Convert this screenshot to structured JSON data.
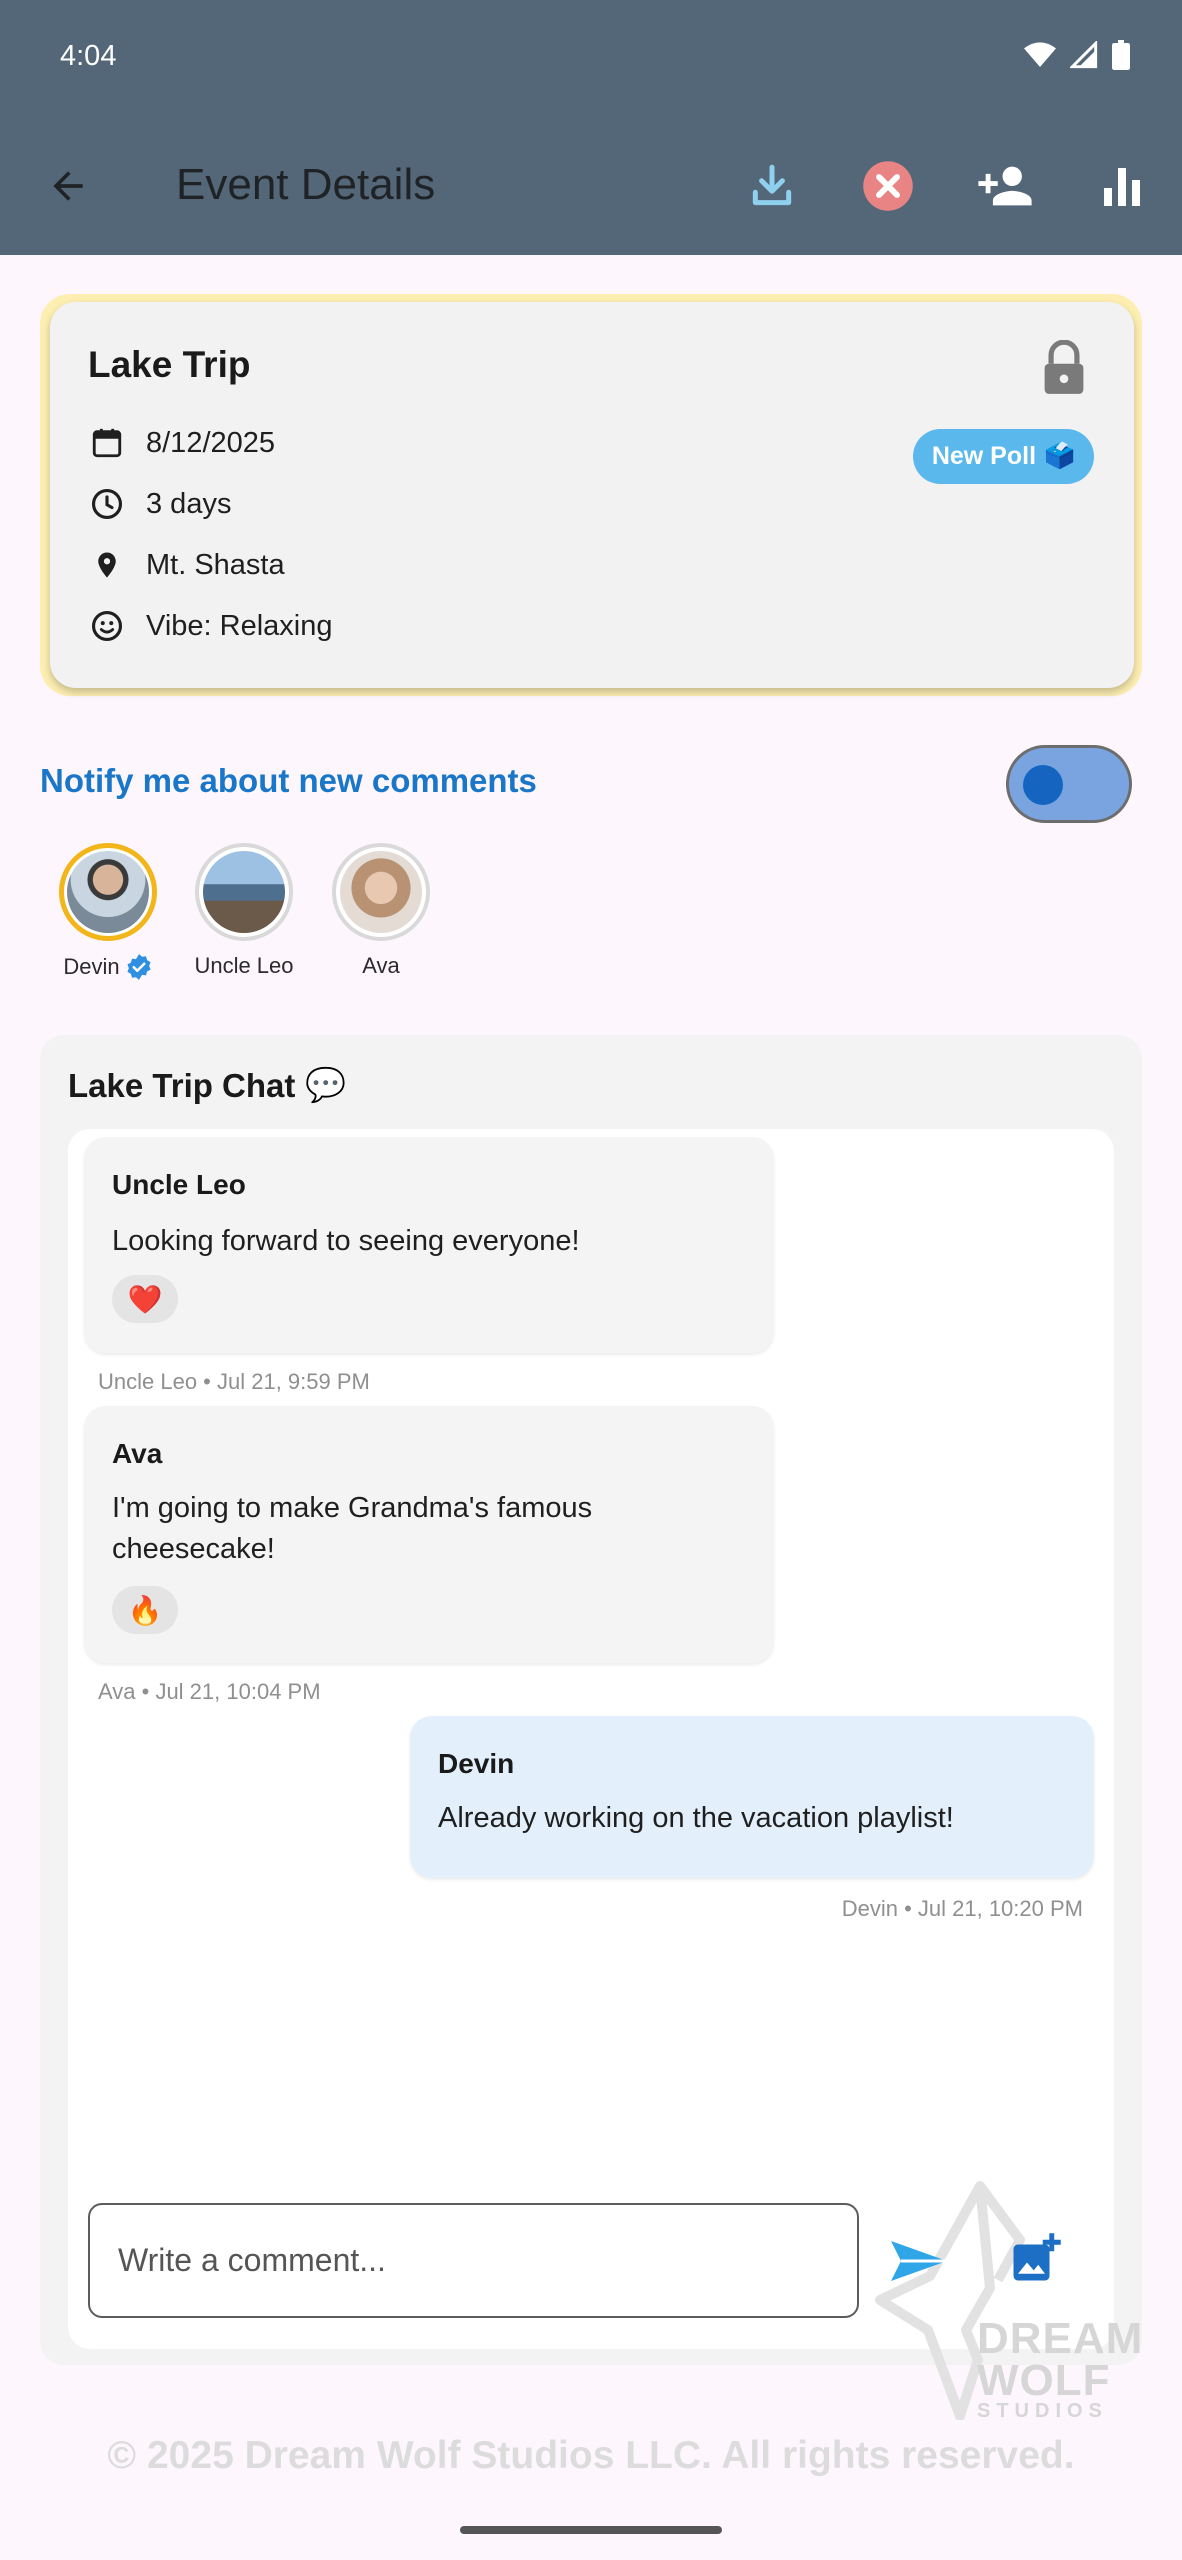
{
  "status_bar": {
    "time": "4:04"
  },
  "app_bar": {
    "title": "Event Details"
  },
  "event": {
    "title": "Lake Trip",
    "date": "8/12/2025",
    "duration": "3 days",
    "location": "Mt. Shasta",
    "vibe": "Vibe: Relaxing",
    "new_poll_label": "New Poll",
    "new_poll_emoji": "🗳️"
  },
  "notify": {
    "label": "Notify me about new comments",
    "enabled": true
  },
  "participants": [
    {
      "name": "Devin"
    },
    {
      "name": "Uncle Leo"
    },
    {
      "name": "Ava"
    }
  ],
  "chat": {
    "title": "Lake Trip Chat",
    "title_emoji": "💬",
    "messages": [
      {
        "author": "Uncle Leo",
        "text": "Looking forward to seeing everyone!",
        "reaction": "❤️",
        "meta": "Uncle Leo • Jul 21, 9:59 PM"
      },
      {
        "author": "Ava",
        "text": "I'm going to make Grandma's famous cheesecake!",
        "reaction": "🔥",
        "meta": "Ava • Jul 21, 10:04 PM"
      },
      {
        "author": "Devin",
        "text": "Already working on the vacation playlist!",
        "meta": "Devin • Jul 21, 10:20 PM"
      }
    ],
    "input_placeholder": "Write a comment..."
  },
  "watermark": {
    "line1": "DREAM",
    "line2": "WOLF",
    "line3": "STUDIOS"
  },
  "footer": "© 2025 Dream Wolf Studios LLC. All rights reserved.",
  "colors": {
    "app_bar": "#546778",
    "accent_blue": "#1976c9",
    "poll_button": "#5ab8ec",
    "host_ring": "#f2b51a",
    "card_highlight": "#fdeeb2",
    "my_bubble": "#e3f0fb"
  }
}
